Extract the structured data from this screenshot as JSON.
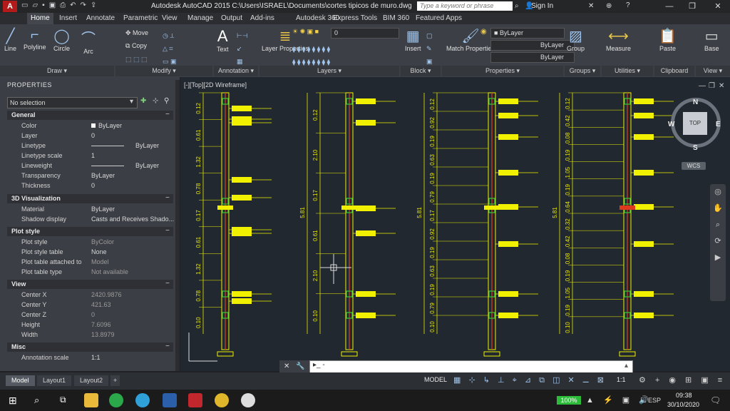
{
  "app": {
    "name_short": "A",
    "title": "Autodesk AutoCAD 2015   C:\\Users\\ISRAEL\\Documents\\cortes tipicos de muro.dwg",
    "search_placeholder": "Type a keyword or phrase",
    "sign_in": "Sign In"
  },
  "ribbon_tabs": [
    "Home",
    "Insert",
    "Annotate",
    "Parametric",
    "View",
    "Manage",
    "Output",
    "Add-ins",
    "Autodesk 360",
    "Express Tools",
    "BIM 360",
    "Featured Apps"
  ],
  "ribbon": {
    "draw": {
      "panel": "Draw",
      "tools": [
        "Line",
        "Polyline",
        "Circle",
        "Arc"
      ]
    },
    "modify": {
      "panel": "Modify",
      "tools": [
        "Move",
        "Copy"
      ]
    },
    "annotation": {
      "panel": "Annotation",
      "tools": [
        "Text"
      ]
    },
    "layers": {
      "panel": "Layers",
      "tool": "Layer Properties",
      "current_layer": "0"
    },
    "block": {
      "panel": "Block",
      "tool": "Insert"
    },
    "properties": {
      "panel": "Properties",
      "tool": "Match Properties",
      "color": "ByLayer",
      "linetype": "ByLayer",
      "lineweight": "ByLayer"
    },
    "groups": {
      "panel": "Groups",
      "tool": "Group"
    },
    "utilities": {
      "panel": "Utilities",
      "tool": "Measure"
    },
    "clipboard": {
      "panel": "Clipboard",
      "tool": "Paste"
    },
    "view": {
      "panel": "View",
      "tool": "Base"
    }
  },
  "properties_palette": {
    "title": "PROPERTIES",
    "selection": "No selection",
    "general": {
      "header": "General",
      "rows": [
        {
          "k": "Color",
          "v": "ByLayer"
        },
        {
          "k": "Layer",
          "v": "0"
        },
        {
          "k": "Linetype",
          "v": "ByLayer"
        },
        {
          "k": "Linetype scale",
          "v": "1"
        },
        {
          "k": "Lineweight",
          "v": "ByLayer"
        },
        {
          "k": "Transparency",
          "v": "ByLayer"
        },
        {
          "k": "Thickness",
          "v": "0"
        }
      ]
    },
    "viz3d": {
      "header": "3D Visualization",
      "rows": [
        {
          "k": "Material",
          "v": "ByLayer"
        },
        {
          "k": "Shadow display",
          "v": "Casts and Receives Shado..."
        }
      ]
    },
    "plot": {
      "header": "Plot style",
      "rows": [
        {
          "k": "Plot style",
          "v": "ByColor"
        },
        {
          "k": "Plot style table",
          "v": "None"
        },
        {
          "k": "Plot table attached to",
          "v": "Model"
        },
        {
          "k": "Plot table type",
          "v": "Not available"
        }
      ]
    },
    "view": {
      "header": "View",
      "rows": [
        {
          "k": "Center X",
          "v": "2420.9876"
        },
        {
          "k": "Center Y",
          "v": "421.63"
        },
        {
          "k": "Center Z",
          "v": "0"
        },
        {
          "k": "Height",
          "v": "7.6096"
        },
        {
          "k": "Width",
          "v": "13.8979"
        }
      ]
    },
    "misc": {
      "header": "Misc",
      "rows": [
        {
          "k": "Annotation scale",
          "v": "1:1"
        }
      ]
    }
  },
  "viewport": {
    "label": "[-][Top][2D Wireframe]",
    "viewcube": {
      "top": "TOP",
      "n": "N",
      "s": "S",
      "e": "E",
      "w": "W",
      "wcs": "WCS"
    },
    "dims": {
      "col1": [
        "0.12",
        "0.61",
        "1.32",
        "0.78",
        "0.17",
        "0.61",
        "1.32",
        "0.78",
        "0.10"
      ],
      "col2": [
        "0.12",
        "2.10",
        "0.17",
        "0.61",
        "2.10",
        "0.10"
      ],
      "col2_total": "5.81",
      "col3": [
        "0.12",
        "0.92",
        "0.19",
        "0.63",
        "0.19",
        "0.79",
        "0.17",
        "0.92",
        "0.19",
        "0.63",
        "0.19",
        "0.79",
        "0.10"
      ],
      "col3_total": "5.81",
      "col4": [
        "0.12",
        "0.42",
        "0.08",
        "0.19",
        "1.05",
        "0.19",
        "0.64",
        "0.32",
        "0.42",
        "0.08",
        "0.19",
        "1.05",
        "0.19",
        "0.10"
      ],
      "col4_total": "5.81"
    },
    "colors": {
      "bg": "#212830",
      "yellow": "#f0f000",
      "green": "#33cc33",
      "red": "#e03a1e",
      "dim": "#e8e800"
    }
  },
  "layout_tabs": [
    "Model",
    "Layout1",
    "Layout2"
  ],
  "status": {
    "model": "MODEL",
    "scale": "1:1"
  },
  "taskbar": {
    "battery": "100%",
    "lang": "ESP",
    "time": "09:38",
    "date": "30/10/2020"
  }
}
